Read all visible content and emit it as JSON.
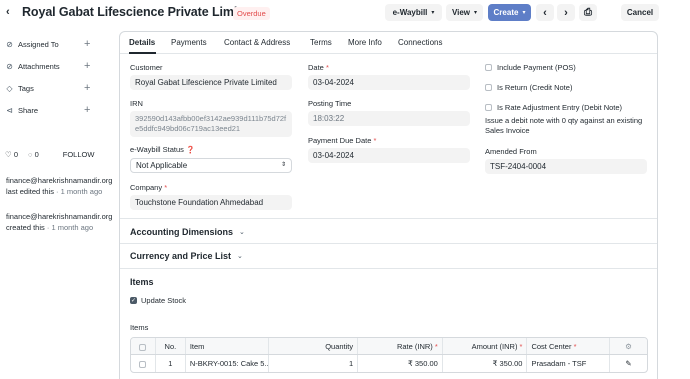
{
  "header": {
    "back_glyph": "‹",
    "title": "Royal Gabat Lifescience Private Limit...",
    "status": "Overdue",
    "buttons": {
      "ewaybill": "e-Waybill",
      "view": "View",
      "create": "Create",
      "prev": "‹",
      "next": "›",
      "print": "⎙",
      "cancel": "Cancel"
    }
  },
  "sidebar": {
    "items": [
      {
        "label": "Assigned To",
        "icon": "assign-icon"
      },
      {
        "label": "Attachments",
        "icon": "paperclip-icon"
      },
      {
        "label": "Tags",
        "icon": "tag-icon"
      },
      {
        "label": "Share",
        "icon": "share-icon"
      }
    ],
    "likes": "0",
    "comments": "0",
    "follow": "FOLLOW",
    "activity": [
      {
        "user": "finance@harekrishnamandir.org",
        "action": "last edited this",
        "time": "· 1 month ago"
      },
      {
        "user": "finance@harekrishnamandir.org",
        "action": "created this",
        "time": "· 1 month ago"
      }
    ]
  },
  "tabs": [
    "Details",
    "Payments",
    "Contact & Address",
    "Terms",
    "More Info",
    "Connections"
  ],
  "form": {
    "customer": {
      "label": "Customer",
      "value": "Royal Gabat Lifescience Private Limited"
    },
    "irn": {
      "label": "IRN",
      "value": "392590d143afbb00ef3142ae939d111b75d72fe5ddfc949bd06c719ac13eed21"
    },
    "ewaybill_status": {
      "label": "e-Waybill Status",
      "value": "Not Applicable"
    },
    "company": {
      "label": "Company",
      "value": "Touchstone Foundation Ahmedabad"
    },
    "date": {
      "label": "Date",
      "value": "03-04-2024"
    },
    "posting_time": {
      "label": "Posting Time",
      "value": "18:03:22"
    },
    "payment_due_date": {
      "label": "Payment Due Date",
      "value": "03-04-2024"
    },
    "include_payment": "Include Payment (POS)",
    "is_return": "Is Return (Credit Note)",
    "is_rate_adjustment": "Is Rate Adjustment Entry (Debit Note)",
    "rate_adjustment_help": "Issue a debit note with 0 qty against an existing Sales Invoice",
    "amended_from": {
      "label": "Amended From",
      "value": "TSF-2404-0004"
    }
  },
  "sections": {
    "accounting": "Accounting Dimensions",
    "currency": "Currency and Price List",
    "items": "Items",
    "update_stock": "Update Stock",
    "items_table_label": "Items"
  },
  "table": {
    "headers": [
      "No.",
      "Item",
      "Quantity",
      "Rate (INR)",
      "Amount (INR)",
      "Cost Center"
    ],
    "rows": [
      {
        "no": "1",
        "item": "N-BKRY-0015: Cake 5...",
        "qty": "1",
        "rate": "₹ 350.00",
        "amount": "₹ 350.00",
        "cost_center": "Prasadam - TSF"
      }
    ]
  }
}
